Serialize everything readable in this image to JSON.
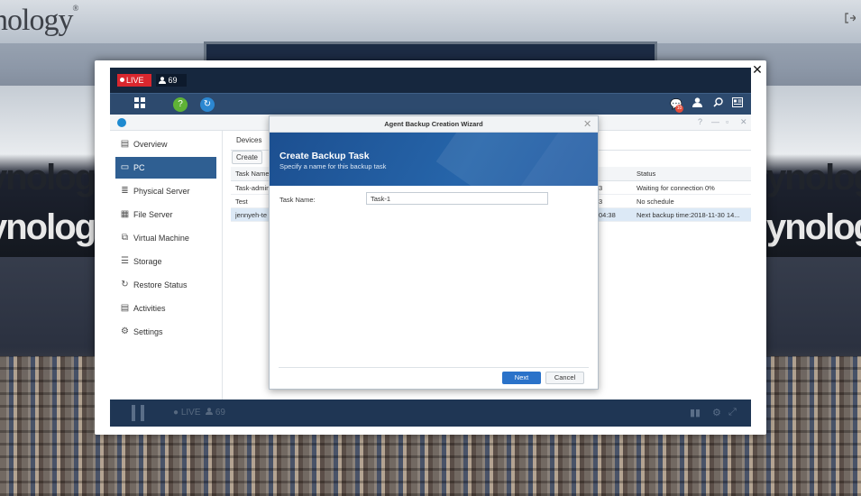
{
  "hall": {
    "logo": "nology",
    "logo_mark": "®",
    "exit_icon": "exit-icon",
    "left_wall_top": "ynology",
    "left_wall_bottom": "ynolog",
    "right_wall_top": "ynology",
    "right_wall_bottom": "ynology"
  },
  "modal": {
    "close_glyph": "✕"
  },
  "stream": {
    "live_label": "LIVE",
    "viewer_count": "69",
    "player_live_label": "LIVE",
    "player_viewer_count": "69"
  },
  "taskbar": {
    "notification_badge": "10"
  },
  "sidebar": {
    "items": [
      {
        "label": "Overview",
        "icon": "overview-icon"
      },
      {
        "label": "PC",
        "icon": "pc-icon"
      },
      {
        "label": "Physical Server",
        "icon": "physical-server-icon"
      },
      {
        "label": "File Server",
        "icon": "file-server-icon"
      },
      {
        "label": "Virtual Machine",
        "icon": "virtual-machine-icon"
      },
      {
        "label": "Storage",
        "icon": "storage-icon"
      },
      {
        "label": "Restore Status",
        "icon": "restore-status-icon"
      },
      {
        "label": "Activities",
        "icon": "activities-icon"
      },
      {
        "label": "Settings",
        "icon": "settings-icon"
      }
    ]
  },
  "main": {
    "tab": "Devices",
    "create_label": "Create",
    "columns": {
      "task_name": "Task Name",
      "status": "Status"
    },
    "rows": [
      {
        "name": "Task-admin",
        "time": "3",
        "status": "Waiting for connection 0%"
      },
      {
        "name": "Test",
        "time": "3",
        "status": "No schedule"
      },
      {
        "name": "jennyeh-te",
        "time": "04:38",
        "status": "Next backup time:2018-11-30 14..."
      }
    ]
  },
  "wizard": {
    "title": "Agent Backup Creation Wizard",
    "heading": "Create Backup Task",
    "subheading": "Specify a name for this backup task",
    "field_label": "Task Name:",
    "field_value": "Task-1",
    "next_label": "Next",
    "cancel_label": "Cancel"
  },
  "colors": {
    "accent": "#2a72c9",
    "live_red": "#d9272e",
    "selected_nav": "#2f5f92"
  }
}
